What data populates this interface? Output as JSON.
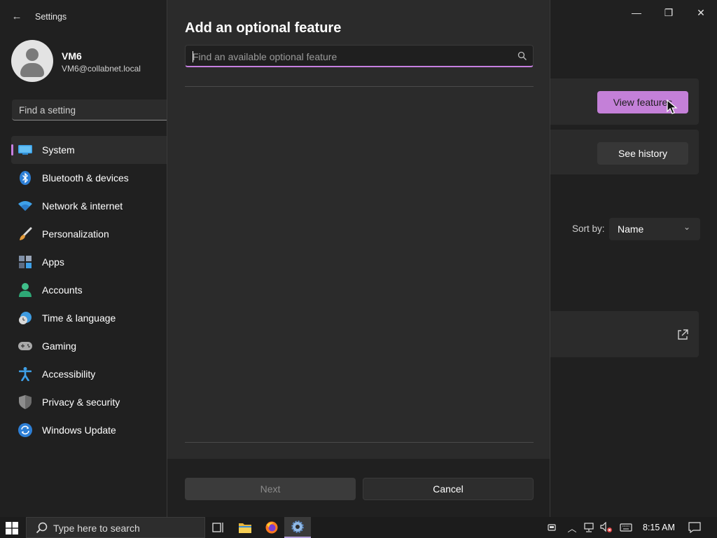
{
  "window": {
    "title": "Settings",
    "controls": {
      "minimize": "—",
      "maximize": "❐",
      "close": "✕"
    }
  },
  "profile": {
    "name": "VM6",
    "email": "VM6@collabnet.local"
  },
  "find_setting": {
    "placeholder": "Find a setting"
  },
  "sidebar": {
    "items": [
      {
        "label": "System",
        "icon": "system-icon",
        "active": true
      },
      {
        "label": "Bluetooth & devices",
        "icon": "bluetooth-icon"
      },
      {
        "label": "Network & internet",
        "icon": "wifi-icon"
      },
      {
        "label": "Personalization",
        "icon": "brush-icon"
      },
      {
        "label": "Apps",
        "icon": "apps-icon"
      },
      {
        "label": "Accounts",
        "icon": "person-icon"
      },
      {
        "label": "Time & language",
        "icon": "clock-globe-icon"
      },
      {
        "label": "Gaming",
        "icon": "gamepad-icon"
      },
      {
        "label": "Accessibility",
        "icon": "accessibility-icon"
      },
      {
        "label": "Privacy & security",
        "icon": "shield-icon"
      },
      {
        "label": "Windows Update",
        "icon": "update-icon"
      }
    ]
  },
  "background": {
    "view_features_label": "View features",
    "see_history_label": "See history",
    "sort_label": "Sort by:",
    "sort_value": "Name"
  },
  "dialog": {
    "title": "Add an optional feature",
    "search_placeholder": "Find an available optional feature",
    "next_label": "Next",
    "cancel_label": "Cancel"
  },
  "taskbar": {
    "search_placeholder": "Type here to search",
    "time": "8:15 AM"
  },
  "colors": {
    "accent": "#c67fe0",
    "background": "#202020",
    "dialog": "#2b2b2b"
  }
}
